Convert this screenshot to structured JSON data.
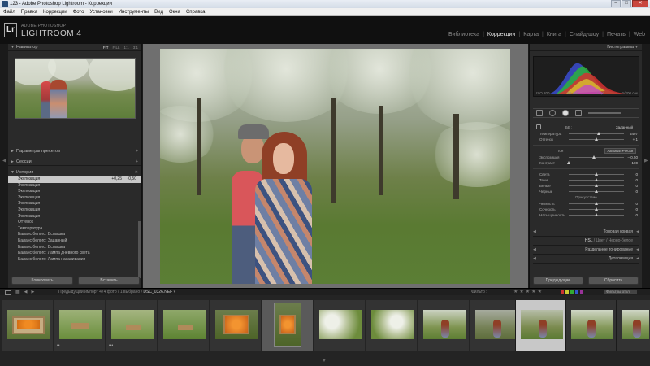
{
  "window": {
    "title": "123 - Adobe Photoshop Lightroom - Коррекции",
    "buttons": {
      "min": "–",
      "max": "□",
      "close": "✕"
    }
  },
  "menu": [
    "Файл",
    "Правка",
    "Коррекции",
    "Фото",
    "Установки",
    "Инструменты",
    "Вид",
    "Окна",
    "Справка"
  ],
  "identity": {
    "logo": "Lr",
    "small": "ADOBE PHOTOSHOP",
    "big": "LIGHTROOM 4"
  },
  "modules": [
    {
      "label": "Библиотека",
      "active": false
    },
    {
      "label": "Коррекции",
      "active": true
    },
    {
      "label": "Карта",
      "active": false
    },
    {
      "label": "Книга",
      "active": false
    },
    {
      "label": "Слайд-шоу",
      "active": false
    },
    {
      "label": "Печать",
      "active": false
    },
    {
      "label": "Web",
      "active": false
    }
  ],
  "left": {
    "navigator": {
      "title": "Навигатор",
      "opts": [
        "FIT",
        "FILL",
        "1:1",
        "3:1"
      ]
    },
    "presets": "Параметры пресетов",
    "snapshots": "Сессии",
    "history": {
      "title": "История",
      "items": [
        {
          "label": "Экспозиция",
          "v1": "+0,25",
          "v2": "-0,50",
          "sel": true
        },
        {
          "label": "Экспозиция",
          "v1": "",
          "v2": "",
          "sel": false
        },
        {
          "label": "Экспозиция",
          "v1": "",
          "v2": "",
          "sel": false
        },
        {
          "label": "Экспозиция",
          "v1": "",
          "v2": "",
          "sel": false
        },
        {
          "label": "Экспозиция",
          "v1": "",
          "v2": "",
          "sel": false
        },
        {
          "label": "Экспозиция",
          "v1": "",
          "v2": "",
          "sel": false
        },
        {
          "label": "Экспозиция",
          "v1": "",
          "v2": "",
          "sel": false
        },
        {
          "label": "Оттенок",
          "v1": "",
          "v2": "",
          "sel": false
        },
        {
          "label": "Температура",
          "v1": "",
          "v2": "",
          "sel": false
        },
        {
          "label": "Баланс белого: Вспышка",
          "v1": "",
          "v2": "",
          "sel": false
        },
        {
          "label": "Баланс белого: Заданный",
          "v1": "",
          "v2": "",
          "sel": false
        },
        {
          "label": "Баланс белого: Вспышка",
          "v1": "",
          "v2": "",
          "sel": false
        },
        {
          "label": "Баланс белого: Лампа дневного света",
          "v1": "",
          "v2": "",
          "sel": false
        },
        {
          "label": "Баланс белого: Лампа накаливания",
          "v1": "",
          "v2": "",
          "sel": false
        }
      ]
    },
    "buttons": {
      "copy": "Копировать",
      "paste": "Вставить"
    }
  },
  "right": {
    "histogram": {
      "title": "Гистограмма",
      "info": [
        "ISO 200",
        "50 мм",
        "f / 2,0",
        "1/200 сек"
      ]
    },
    "basic": {
      "wb_label": "ББ :",
      "wb_value": "Заданный",
      "temp": {
        "label": "Температура",
        "value": "5497",
        "pos": 0.55
      },
      "tint": {
        "label": "Оттенок",
        "value": "+ 1",
        "pos": 0.5
      },
      "tone_label": "Тон",
      "auto": "Автоматически",
      "exposure": {
        "label": "Экспозиция",
        "value": "– 0,50",
        "pos": 0.46
      },
      "contrast": {
        "label": "Контраст",
        "value": "– 100",
        "pos": 0.0
      },
      "highlights": {
        "label": "Света",
        "value": "0",
        "pos": 0.5
      },
      "shadows": {
        "label": "Тени",
        "value": "0",
        "pos": 0.5
      },
      "whites": {
        "label": "Белые",
        "value": "0",
        "pos": 0.5
      },
      "blacks": {
        "label": "Черные",
        "value": "0",
        "pos": 0.5
      },
      "presence_label": "Присутствие",
      "clarity": {
        "label": "Четкость",
        "value": "0",
        "pos": 0.5
      },
      "vibrance": {
        "label": "Сочность",
        "value": "0",
        "pos": 0.5
      },
      "saturation": {
        "label": "Насыщенность",
        "value": "0",
        "pos": 0.5
      }
    },
    "sections": {
      "tone_curve": "Тоновая кривая",
      "hsl": [
        "HSL",
        "/",
        "Цвет",
        "/",
        "Черно-белое"
      ],
      "split": "Раздельное тонирование",
      "detail": "Детализация"
    },
    "buttons": {
      "previous": "Предыдущие",
      "reset": "Сбросить"
    }
  },
  "toolbar": {
    "info": "Предыдущий импорт   474 фото / 1 выбрано /",
    "filename": "DSC_0326.NEF",
    "filter": "Фильтр :",
    "filter_off": "Фильтры откл"
  },
  "filmstrip": {
    "frames": [
      {
        "kind": "crates",
        "badge": ""
      },
      {
        "kind": "grass",
        "badge": "••"
      },
      {
        "kind": "grass",
        "badge": "•••"
      },
      {
        "kind": "grass",
        "badge": ""
      },
      {
        "kind": "oranges",
        "badge": ""
      },
      {
        "kind": "vertical-oranges",
        "badge": ""
      },
      {
        "kind": "blossom",
        "badge": ""
      },
      {
        "kind": "blossom",
        "badge": ""
      },
      {
        "kind": "couple",
        "badge": ""
      },
      {
        "kind": "couple-dim",
        "badge": ""
      },
      {
        "kind": "couple-selected",
        "badge": ""
      },
      {
        "kind": "couple",
        "badge": ""
      },
      {
        "kind": "couple",
        "badge": ""
      }
    ]
  }
}
